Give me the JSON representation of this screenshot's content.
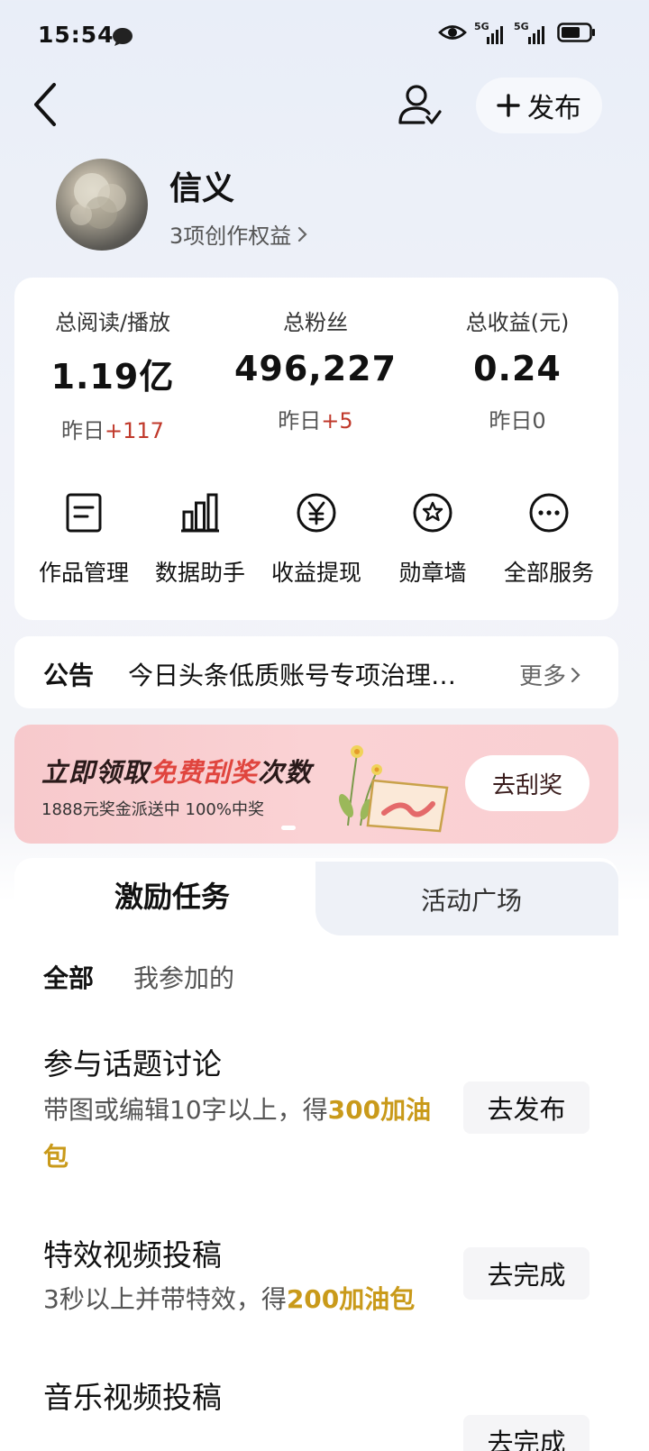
{
  "status_bar": {
    "time": "15:54",
    "signal_1": "5G",
    "signal_2": "5G"
  },
  "nav": {
    "publish_label": "发布"
  },
  "profile": {
    "name": "信义",
    "benefits": "3项创作权益"
  },
  "stats": [
    {
      "label": "总阅读/播放",
      "value": "1.19亿",
      "delta_prefix": "昨日",
      "delta_value": "+117"
    },
    {
      "label": "总粉丝",
      "value": "496,227",
      "delta_prefix": "昨日",
      "delta_value": "+5"
    },
    {
      "label": "总收益(元)",
      "value": "0.24",
      "delta_prefix": "昨日",
      "delta_value": "0"
    }
  ],
  "services": [
    {
      "label": "作品管理",
      "icon": "document-icon"
    },
    {
      "label": "数据助手",
      "icon": "bar-chart-icon"
    },
    {
      "label": "收益提现",
      "icon": "yuan-icon"
    },
    {
      "label": "勋章墙",
      "icon": "medal-icon"
    },
    {
      "label": "全部服务",
      "icon": "more-icon"
    }
  ],
  "announcement": {
    "label": "公告",
    "text": "今日头条低质账号专项治理…",
    "more": "更多"
  },
  "banner": {
    "title_pre": "立即领取",
    "title_hl": "免费刮奖",
    "title_post": "次数",
    "subtitle": "1888元奖金派送中 100%中奖",
    "button": "去刮奖"
  },
  "tabs": {
    "active": "激励任务",
    "inactive": "活动广场"
  },
  "filters": {
    "all": "全部",
    "mine": "我参加的"
  },
  "tasks": [
    {
      "title": "参与话题讨论",
      "desc": "带图或编辑10字以上，得",
      "reward": "300加油包",
      "button": "去发布"
    },
    {
      "title": "特效视频投稿",
      "desc": "3秒以上并带特效，得",
      "reward": "200加油包",
      "button": "去完成"
    },
    {
      "title": "音乐视频投稿",
      "button": "去完成"
    }
  ]
}
